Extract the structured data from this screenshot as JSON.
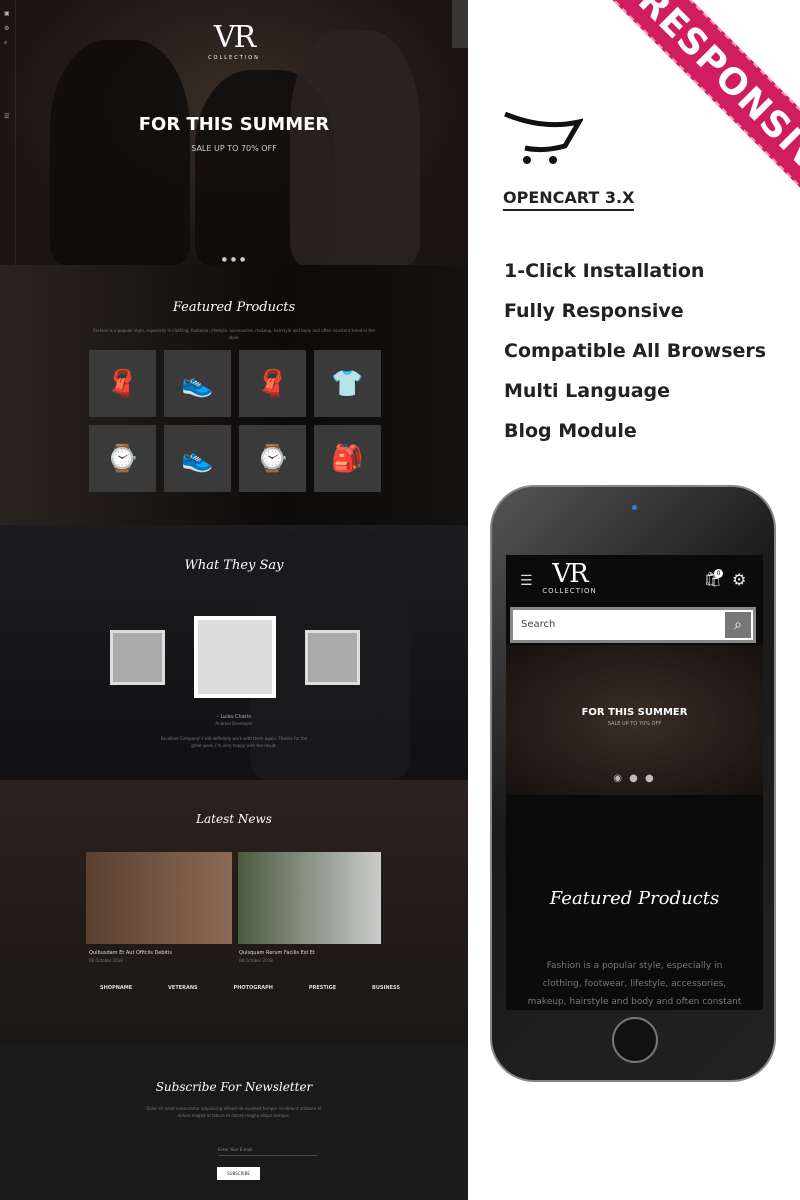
{
  "desktop": {
    "logo": {
      "main": "VR",
      "sub": "COLLECTION"
    },
    "hero": {
      "title": "FOR THIS SUMMER",
      "subtitle": "SALE UP TO 70% OFF"
    },
    "featured": {
      "title": "Featured Products",
      "description": "Fashion is a popular style, especially in clothing, footwear, lifestyle, accessories, makeup, hairstyle and body and often constant trend in the style.",
      "products": [
        "scarf",
        "sneaker",
        "scarf",
        "t-shirt",
        "watch",
        "sneaker",
        "watch",
        "backpack"
      ]
    },
    "testimonials": {
      "title": "What They Say",
      "name": "- Luies Charls",
      "role": "Android Developer",
      "quote": "Excellent Company! I will definitely work with them again. Thanks for the great work. I'm very happy with the result."
    },
    "news": {
      "title": "Latest News",
      "posts": [
        {
          "title": "Quibusdam Et Aut Officiis Debitis",
          "date": "08 October 2018"
        },
        {
          "title": "Quisquam Rerum Facilis Est Et",
          "date": "08 October 2018"
        }
      ],
      "brands": [
        "SHOPNAME",
        "VETERANS",
        "PHOTOGRAPH",
        "PRESTIGE",
        "BUSINESS"
      ]
    },
    "newsletter": {
      "title": "Subscribe For Newsletter",
      "description": "Dolor sit amet consectetur adipisicing elitsed do eiusmod tempor incididunt utlabore et dolore magna ut labore et dolore magna aliqua tempus.",
      "placeholder": "Enter Your E-mail",
      "button": "SUBSCRIBE"
    }
  },
  "promo": {
    "ribbon": "RESPONSIVE",
    "platform": "OPENCART 3.X",
    "features": [
      "1-Click Installation",
      "Fully Responsive",
      "Compatible All Browsers",
      "Multi Language",
      "Blog Module"
    ],
    "ribbon_color": "#cf1d5f"
  },
  "mobile": {
    "logo": {
      "main": "VR",
      "sub": "COLLECTION"
    },
    "cart_count": "0",
    "search_placeholder": "Search",
    "hero": {
      "title": "FOR THIS SUMMER",
      "subtitle": "SALE UP TO 70% OFF"
    },
    "featured": {
      "title": "Featured Products",
      "description": "Fashion is a popular style, especially in clothing, footwear, lifestyle, accessories, makeup, hairstyle and body and often constant"
    }
  }
}
